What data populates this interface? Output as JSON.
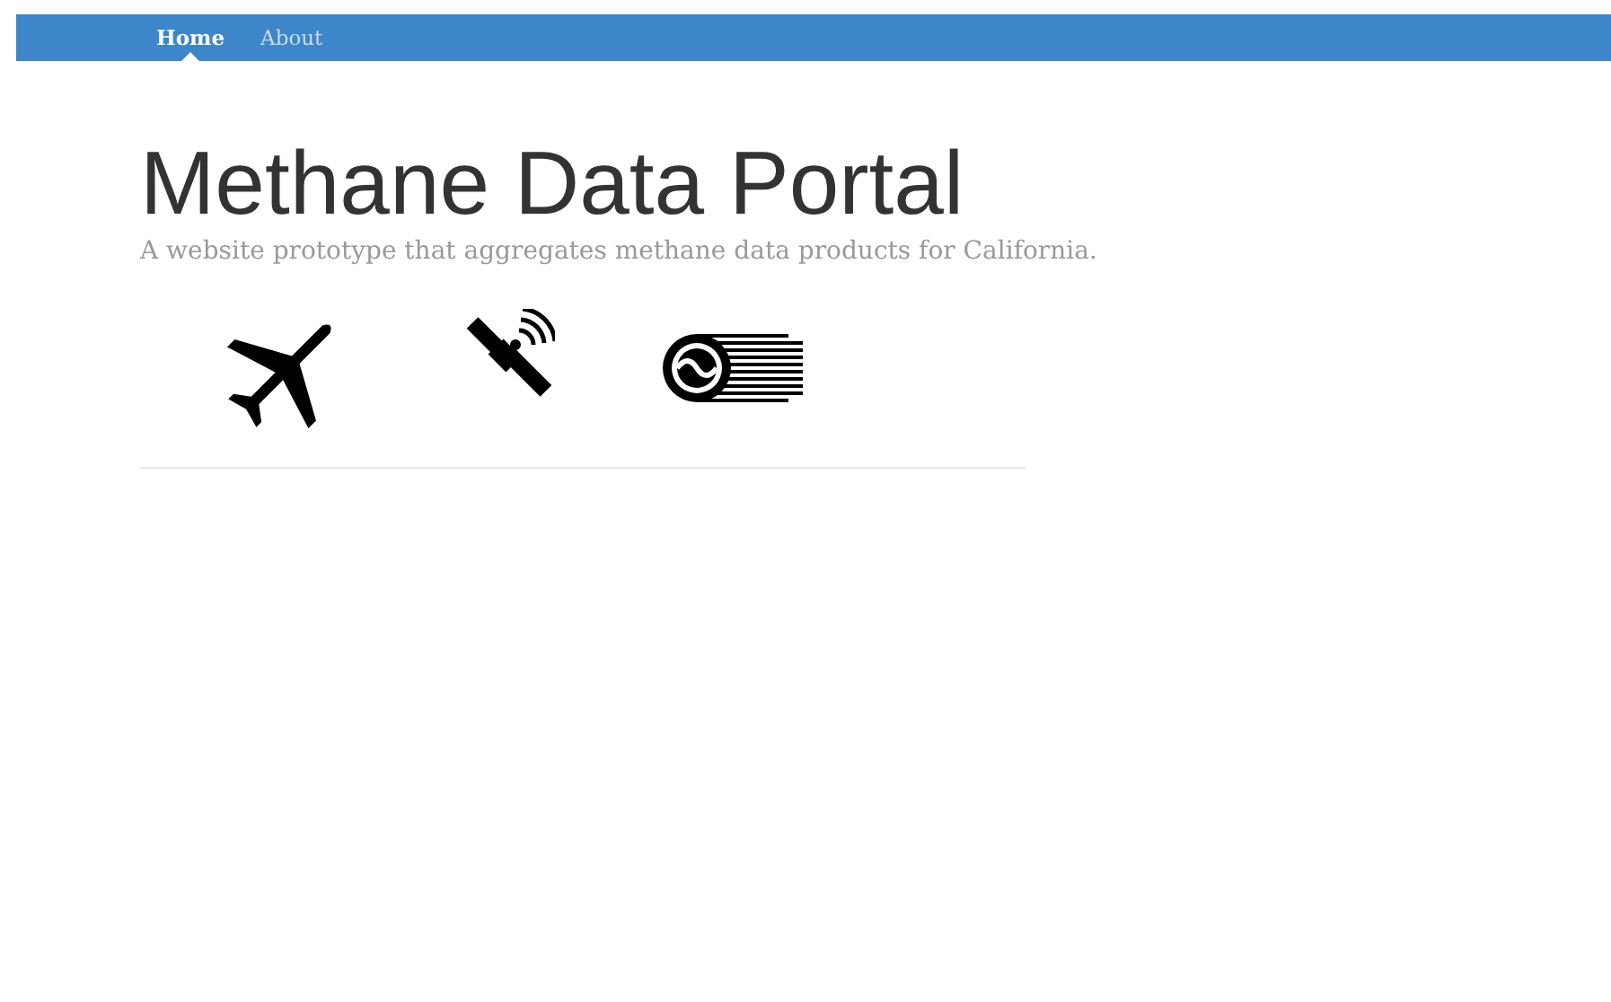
{
  "nav": {
    "items": [
      {
        "label": "Home",
        "selected": true
      },
      {
        "label": "About",
        "selected": false
      }
    ]
  },
  "header": {
    "title": "Methane Data Portal",
    "subtitle": "A website prototype that aggregates methane data products for California."
  },
  "icons": [
    {
      "kind": "plane"
    },
    {
      "kind": "satellite"
    },
    {
      "kind": "sensor"
    }
  ]
}
